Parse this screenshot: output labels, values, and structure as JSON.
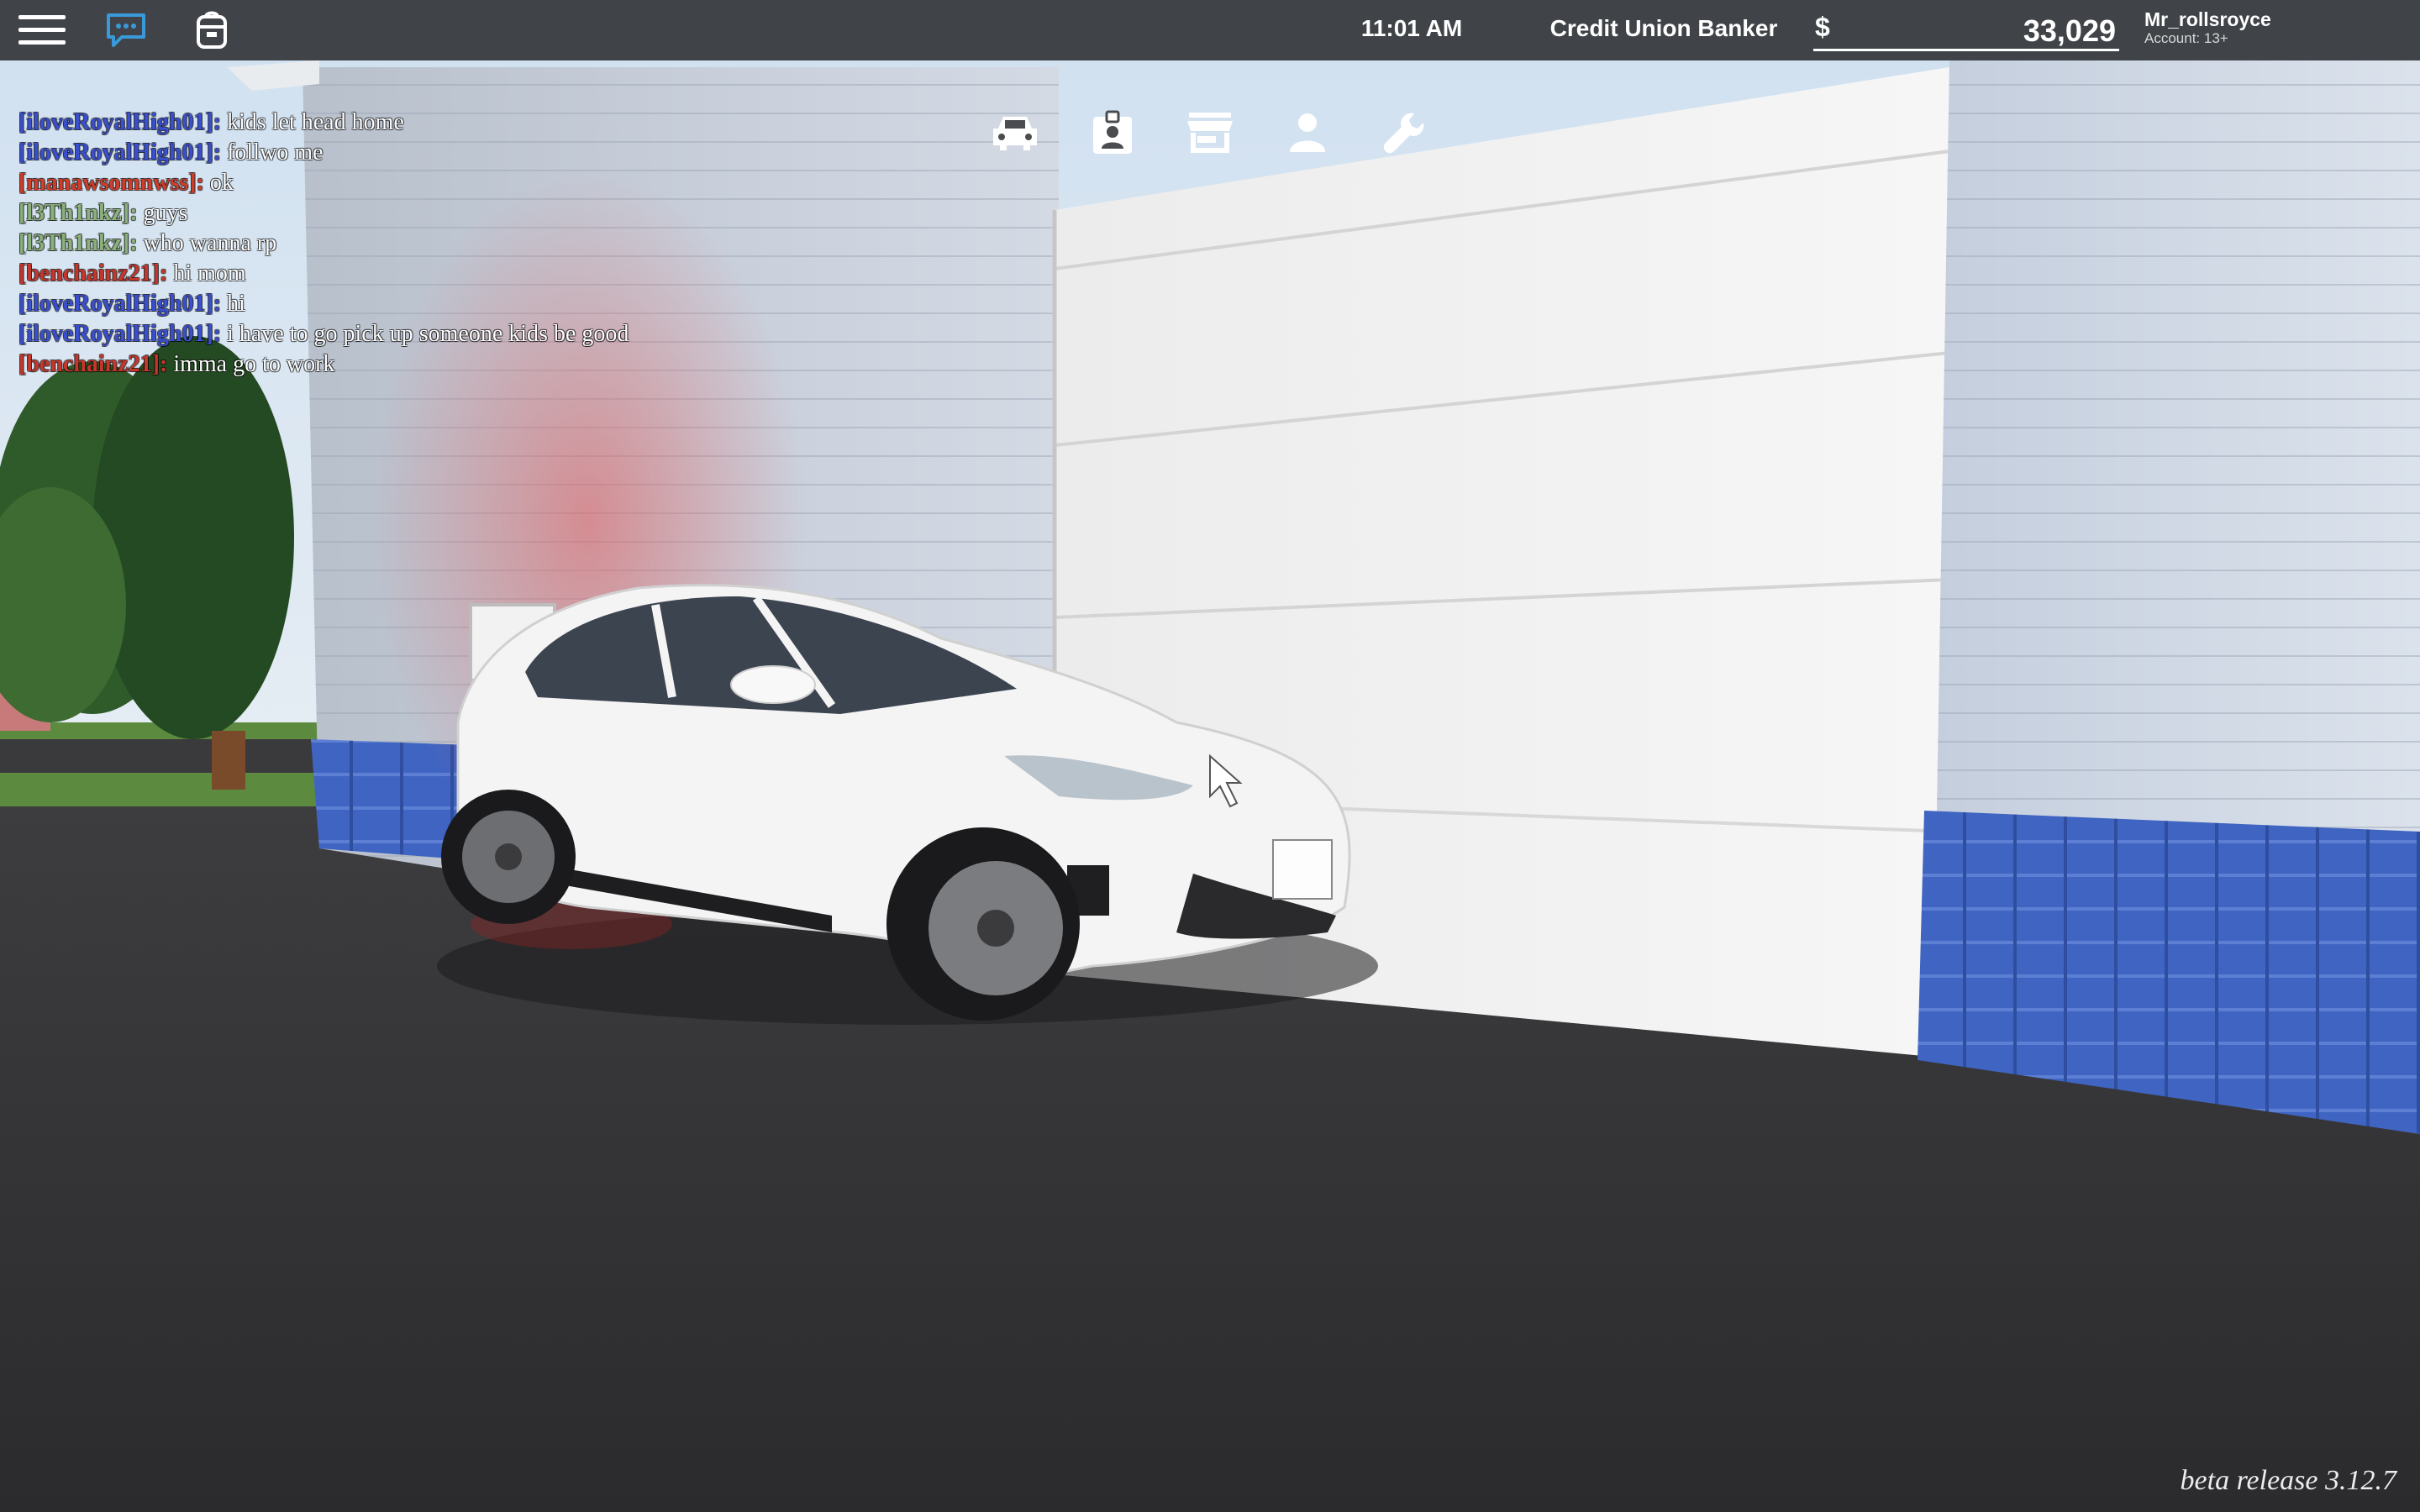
{
  "hud": {
    "time": "11:01 AM",
    "job": "Credit Union Banker",
    "currency_symbol": "$",
    "money": "33,029",
    "username": "Mr_rollsroyce",
    "account": "Account: 13+"
  },
  "icons": {
    "menu": "hamburger-menu-icon",
    "chat": "chat-bubble-icon",
    "backpack": "backpack-icon",
    "toolbar": [
      "car-icon",
      "id-badge-icon",
      "store-icon",
      "person-icon",
      "wrench-icon"
    ]
  },
  "chat": [
    {
      "name": "[iloveRoyalHigh01]:",
      "color": "#3a4fd0",
      "text": "kids let head home"
    },
    {
      "name": "[iloveRoyalHigh01]:",
      "color": "#3a4fd0",
      "text": "follwo me"
    },
    {
      "name": "[manawsomnwss]:",
      "color": "#d23c28",
      "text": "ok"
    },
    {
      "name": "[l3Th1nkz]:",
      "color": "#8bb17a",
      "text": "guys"
    },
    {
      "name": "[l3Th1nkz]:",
      "color": "#8bb17a",
      "text": "who wanna rp"
    },
    {
      "name": "[benchainz21]:",
      "color": "#c8362b",
      "text": "hi mom"
    },
    {
      "name": "[iloveRoyalHigh01]:",
      "color": "#3a4fd0",
      "text": "hi"
    },
    {
      "name": "[iloveRoyalHigh01]:",
      "color": "#3a4fd0",
      "text": "i have to go pick up someone kids be good"
    },
    {
      "name": "[benchainz21]:",
      "color": "#c8362b",
      "text": "imma go to work"
    }
  ],
  "footer": {
    "version": "beta release 3.12.7"
  },
  "colors": {
    "topbar": "#202022",
    "chat_accent": "#3a9ad9",
    "trim_blue": "#3d63c4"
  }
}
